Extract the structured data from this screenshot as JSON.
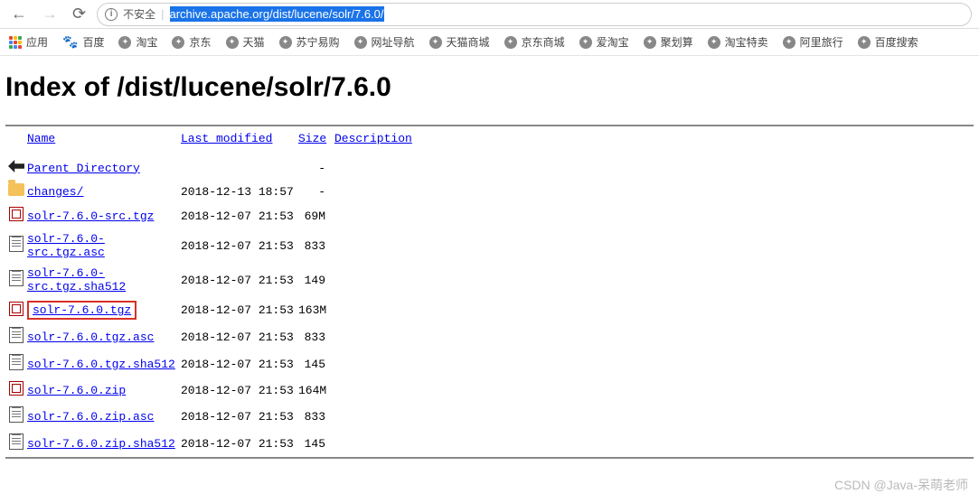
{
  "browser": {
    "insecure_label": "不安全",
    "url_host": "archive.apache.org/dist/lucene/solr/7.6.0/"
  },
  "bookmarks": {
    "apps": "应用",
    "items": [
      {
        "label": "百度",
        "icon": "paw"
      },
      {
        "label": "淘宝",
        "icon": "globe"
      },
      {
        "label": "京东",
        "icon": "globe"
      },
      {
        "label": "天猫",
        "icon": "globe"
      },
      {
        "label": "苏宁易购",
        "icon": "globe"
      },
      {
        "label": "网址导航",
        "icon": "globe"
      },
      {
        "label": "天猫商城",
        "icon": "globe"
      },
      {
        "label": "京东商城",
        "icon": "globe"
      },
      {
        "label": "爱淘宝",
        "icon": "globe"
      },
      {
        "label": "聚划算",
        "icon": "globe"
      },
      {
        "label": "淘宝特卖",
        "icon": "globe"
      },
      {
        "label": "阿里旅行",
        "icon": "globe"
      },
      {
        "label": "百度搜索",
        "icon": "globe"
      }
    ]
  },
  "page": {
    "heading": "Index of /dist/lucene/solr/7.6.0",
    "headers": {
      "name": "Name",
      "last_modified": "Last modified",
      "size": "Size",
      "description": "Description"
    },
    "rows": [
      {
        "icon": "back",
        "name": "Parent Directory",
        "mod": "",
        "size": "-",
        "hl": false
      },
      {
        "icon": "folder",
        "name": "changes/",
        "mod": "2018-12-13 18:57",
        "size": "-",
        "hl": false
      },
      {
        "icon": "archive",
        "name": "solr-7.6.0-src.tgz",
        "mod": "2018-12-07 21:53",
        "size": "69M",
        "hl": false
      },
      {
        "icon": "file",
        "name": "solr-7.6.0-src.tgz.asc",
        "mod": "2018-12-07 21:53",
        "size": "833",
        "hl": false
      },
      {
        "icon": "file",
        "name": "solr-7.6.0-src.tgz.sha512",
        "mod": "2018-12-07 21:53",
        "size": "149",
        "hl": false
      },
      {
        "icon": "archive",
        "name": "solr-7.6.0.tgz",
        "mod": "2018-12-07 21:53",
        "size": "163M",
        "hl": true
      },
      {
        "icon": "file",
        "name": "solr-7.6.0.tgz.asc",
        "mod": "2018-12-07 21:53",
        "size": "833",
        "hl": false
      },
      {
        "icon": "file",
        "name": "solr-7.6.0.tgz.sha512",
        "mod": "2018-12-07 21:53",
        "size": "145",
        "hl": false
      },
      {
        "icon": "archive",
        "name": "solr-7.6.0.zip",
        "mod": "2018-12-07 21:53",
        "size": "164M",
        "hl": false
      },
      {
        "icon": "file",
        "name": "solr-7.6.0.zip.asc",
        "mod": "2018-12-07 21:53",
        "size": "833",
        "hl": false
      },
      {
        "icon": "file",
        "name": "solr-7.6.0.zip.sha512",
        "mod": "2018-12-07 21:53",
        "size": "145",
        "hl": false
      }
    ]
  },
  "watermark": "CSDN @Java-呆萌老师"
}
